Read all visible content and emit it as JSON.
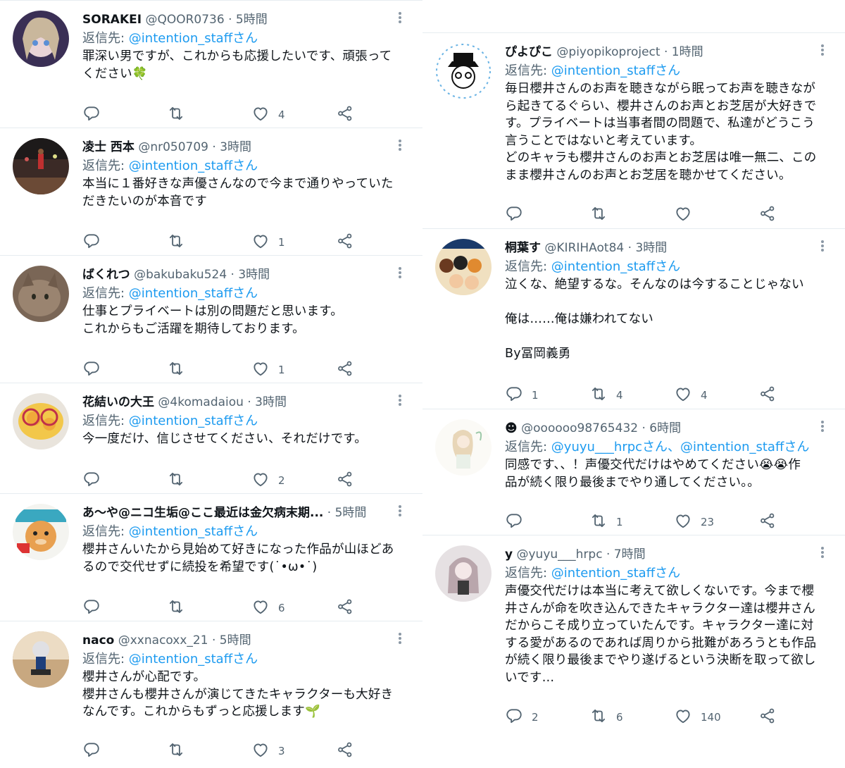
{
  "columns": [
    {
      "tweets": [
        {
          "name": "SORAKEI",
          "handle": "@QOOR0736",
          "time": "5時間",
          "reply_label": "返信先: ",
          "reply_to": "@intention_staffさん",
          "text": "罪深い男ですが、これからも応援したいです、頑張って\nください🍀",
          "replies": "",
          "retweets": "",
          "likes": "4",
          "avatar_icon": "anime-girl-avatar"
        },
        {
          "name": "凌士 西本",
          "handle": "@nr050709",
          "time": "3時間",
          "reply_label": "返信先: ",
          "reply_to": "@intention_staffさん",
          "text": "本当に１番好きな声優さんなので今まで通りやっていた\nだきたいのが本音です",
          "replies": "",
          "retweets": "",
          "likes": "1",
          "avatar_icon": "basketball-avatar"
        },
        {
          "name": "ばくれつ",
          "handle": "@bakubaku524",
          "time": "3時間",
          "reply_label": "返信先: ",
          "reply_to": "@intention_staffさん",
          "text": "仕事とプライベートは別の問題だと思います。\nこれからもご活躍を期待しております。",
          "replies": "",
          "retweets": "",
          "likes": "1",
          "avatar_icon": "cat-avatar"
        },
        {
          "name": "花結いの大王",
          "handle": "@4komadaiou",
          "time": "3時間",
          "reply_label": "返信先: ",
          "reply_to": "@intention_staffさん",
          "text": "今一度だけ、信じさせてください、それだけです。",
          "replies": "",
          "retweets": "",
          "likes": "2",
          "avatar_icon": "food-glasses-avatar"
        },
        {
          "name": "あ〜や@ニコ生垢@ここ最近は金欠病末期...",
          "handle": "",
          "time": "5時間",
          "reply_label": "返信先: ",
          "reply_to": "@intention_staffさん",
          "text": "櫻井さんいたから見始めて好きになった作品が山ほどあ\nるので交代せずに続投を希望です(˙•ω•˙)",
          "replies": "",
          "retweets": "",
          "likes": "6",
          "avatar_icon": "cartoon-bear-avatar"
        },
        {
          "name": "naco",
          "handle": "@xxnacoxx_21",
          "time": "5時間",
          "reply_label": "返信先: ",
          "reply_to": "@intention_staffさん",
          "text": "櫻井さんが心配です。\n櫻井さんも櫻井さんが演じてきたキャラクターも大好き\nなんです。これからもずっと応援します🌱",
          "replies": "",
          "retweets": "",
          "likes": "3",
          "avatar_icon": "figure-avatar"
        }
      ]
    },
    {
      "tweets": [
        {
          "name": "ぴよぴこ",
          "handle": "@piyopikoproject",
          "time": "1時間",
          "reply_label": "返信先: ",
          "reply_to": "@intention_staffさん",
          "text": "毎日櫻井さんのお声を聴きながら眠ってお声を聴きなが\nら起きてるぐらい、櫻井さんのお声とお芝居が大好きで\nす。プライベートは当事者間の問題で、私達がどうこう\n言うことではないと考えています。\nどのキャラも櫻井さんのお声とお芝居は唯一無二、この\nまま櫻井さんのお声とお芝居を聴かせてください。",
          "replies": "",
          "retweets": "",
          "likes": "",
          "avatar_icon": "hat-boy-avatar"
        },
        {
          "name": "桐葉す",
          "handle": "@KIRIHAot84",
          "time": "3時間",
          "reply_label": "返信先: ",
          "reply_to": "@intention_staffさん",
          "text": "泣くな、絶望するな。そんなのは今することじゃない\n\n俺は……俺は嫌われてない\n\nBy冨岡義勇",
          "replies": "1",
          "retweets": "4",
          "likes": "4",
          "avatar_icon": "anime-group-avatar"
        },
        {
          "name": "☻",
          "handle": "@oooooo98765432",
          "time": "6時間",
          "reply_label": "返信先: ",
          "reply_to": "@yuyu___hrpcさん、@intention_staffさん",
          "text": "同感です、、！声優交代だけはやめてください😭😭作\n品が続く限り最後までやり通してください。。",
          "replies": "",
          "retweets": "1",
          "likes": "23",
          "avatar_icon": "sketch-girl-avatar"
        },
        {
          "name": "y",
          "handle": "@yuyu___hrpc",
          "time": "7時間",
          "reply_label": "返信先: ",
          "reply_to": "@intention_staffさん",
          "text": "声優交代だけは本当に考えて欲しくないです。今まで櫻\n井さんが命を吹き込んできたキャラクター達は櫻井さん\nだからこそ成り立っていたんです。キャラクター達に対\nする愛があるのであれば周りから批難があろうとも作品\nが続く限り最後までやり遂げるという決断を取って欲し\nいです…",
          "replies": "2",
          "retweets": "6",
          "likes": "140",
          "avatar_icon": "sketch-girl-pink-avatar"
        }
      ]
    }
  ],
  "icons": {
    "reply": "reply-icon",
    "retweet": "retweet-icon",
    "like": "like-icon",
    "share": "share-icon",
    "more": "more-icon"
  },
  "colors": {
    "mention": "#1d9bf0",
    "secondary_text": "#536471",
    "divider": "#e6ecf0"
  }
}
